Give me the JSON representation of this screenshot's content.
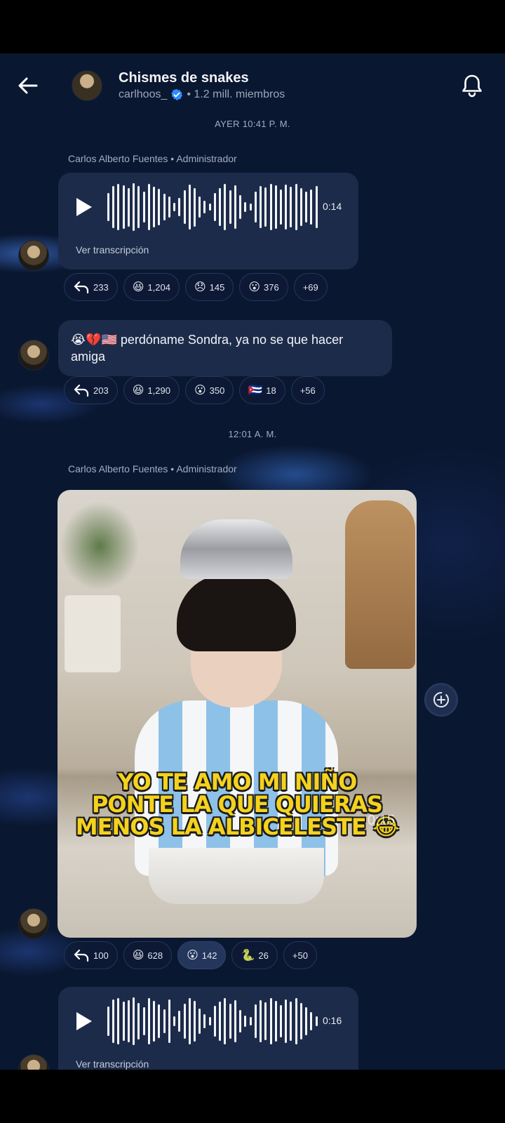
{
  "header": {
    "title": "Chismes de snakes",
    "handle": "carlhoos_",
    "members": "• 1.2 mill. miembros"
  },
  "timestamps": [
    "AYER 10:41 P. M.",
    "12:01 A. M."
  ],
  "messages": [
    {
      "author": "Carlos Alberto Fuentes • Administrador",
      "type": "voice",
      "duration": "0:14",
      "transcription_label": "Ver transcripción",
      "reactions": [
        {
          "icon": "reply-icon",
          "count": "233"
        },
        {
          "emoji": "😆",
          "count": "1,204"
        },
        {
          "emoji": "😞",
          "count": "145"
        },
        {
          "emoji": "😮",
          "count": "376"
        },
        {
          "count": "+69"
        }
      ]
    },
    {
      "type": "text",
      "text": "😭💔🇺🇸 perdóname Sondra, ya no se que hacer amiga",
      "reactions": [
        {
          "icon": "reply-icon",
          "count": "203"
        },
        {
          "emoji": "😆",
          "count": "1,290"
        },
        {
          "emoji": "😮",
          "count": "350"
        },
        {
          "emoji": "🇨🇺",
          "count": "18"
        },
        {
          "count": "+56"
        }
      ]
    },
    {
      "author": "Carlos Alberto Fuentes • Administrador",
      "type": "image",
      "caption_lines": [
        "YO TE AMO MI NIÑO",
        "PONTE LA QUE QUIERAS",
        "MENOS LA ALBICELESTE 😂"
      ],
      "overlay": "0:15",
      "reactions": [
        {
          "icon": "reply-icon",
          "count": "100"
        },
        {
          "emoji": "😆",
          "count": "628"
        },
        {
          "emoji": "😮",
          "count": "142",
          "active": true
        },
        {
          "emoji": "🐍",
          "count": "26"
        },
        {
          "count": "+50"
        }
      ]
    },
    {
      "type": "voice",
      "duration": "0:16",
      "transcription_label": "Ver transcripción"
    }
  ],
  "colors": {
    "background": "#0a1730",
    "bubble": "#1d2b4a",
    "verified": "#2f8cff",
    "caption": "#f4d21d"
  }
}
